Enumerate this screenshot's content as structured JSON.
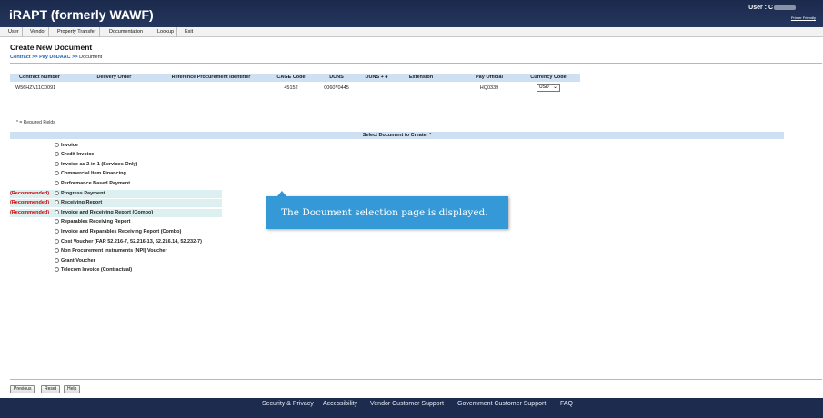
{
  "header": {
    "title": "iRAPT (formerly WAWF)",
    "user_label": "User : C",
    "printer_link": "Printer Friendly"
  },
  "menu": [
    "User",
    "Vendor",
    "Property Transfer",
    "Documentation",
    "Lookup",
    "Exit"
  ],
  "page": {
    "title": "Create New Document",
    "breadcrumb_link": "Contract >> Pay DoDAAC >>",
    "breadcrumb_current": "Document"
  },
  "contract_table": {
    "columns": [
      "Contract Number",
      "Delivery Order",
      "Reference Procurement Identifier",
      "CAGE Code",
      "DUNS",
      "DUNS + 4",
      "Extension",
      "Pay Official",
      "Currency Code"
    ],
    "row": {
      "contract_number": "W56HZV11C0091",
      "delivery_order": "",
      "reference_procurement_identifier": "",
      "cage_code": "45152",
      "duns": "006070445",
      "duns_plus4": "",
      "extension": "",
      "pay_official": "HQ0339",
      "currency_code": "USD"
    }
  },
  "required_note": "* = Required Fields",
  "select_header": "Select Document to Create: *",
  "recommended_label": "(Recommended)",
  "document_options": [
    {
      "label": "Invoice",
      "recommended": false
    },
    {
      "label": "Credit Invoice",
      "recommended": false
    },
    {
      "label": "Invoice as 2-in-1 (Services Only)",
      "recommended": false
    },
    {
      "label": "Commercial Item Financing",
      "recommended": false
    },
    {
      "label": "Performance Based Payment",
      "recommended": false
    },
    {
      "label": "Progress Payment",
      "recommended": true
    },
    {
      "label": "Receiving Report",
      "recommended": true
    },
    {
      "label": "Invoice and Receiving Report (Combo)",
      "recommended": true
    },
    {
      "label": "Reparables Receiving Report",
      "recommended": false
    },
    {
      "label": "Invoice and Reparables Receiving Report (Combo)",
      "recommended": false
    },
    {
      "label": "Cost Voucher (FAR 52.216-7, 52.216-13, 52.216.14, 52.232-7)",
      "recommended": false
    },
    {
      "label": "Non Procurement Instruments (NPI) Voucher",
      "recommended": false
    },
    {
      "label": "Grant Voucher",
      "recommended": false
    },
    {
      "label": "Telecom Invoice (Contractual)",
      "recommended": false
    }
  ],
  "callout": "The Document selection page is displayed.",
  "buttons": {
    "previous": "Previous",
    "reset": "Reset",
    "help": "Help"
  },
  "footer": [
    "Security & Privacy",
    "Accessibility",
    "Vendor Customer Support",
    "Government Customer Support",
    "FAQ"
  ],
  "colors": {
    "header_bg": "#1b2a4c",
    "table_header_bg": "#cfe0f3",
    "recommended_bg": "#dcf0f2",
    "recommended_text": "#cc0000",
    "callout_bg": "#3599d7",
    "link": "#2366b3"
  }
}
